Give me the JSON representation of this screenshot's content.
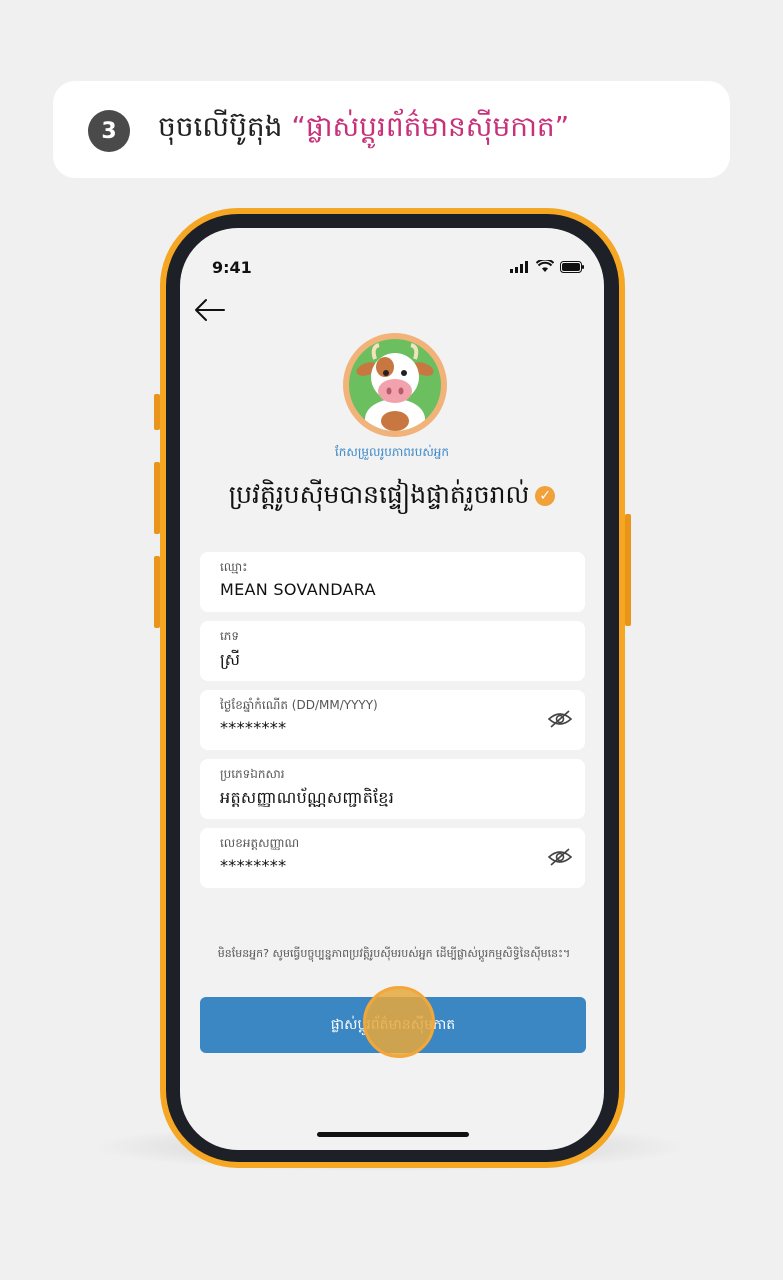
{
  "instruction": {
    "step_number": "3",
    "text_prefix": "ចុចលើប៊ូតុង ",
    "highlight": "“ផ្លាស់ប្តូរព័ត៌មានស៊ីមកាត”"
  },
  "status_bar": {
    "time": "9:41"
  },
  "profile": {
    "edit_link": "កែសម្រួលរូបភាពរបស់អ្នក",
    "verified_title": "ប្រវត្តិរូបស៊ីមបានផ្ទៀងផ្ទាត់រួចរាល់",
    "check_glyph": "✓"
  },
  "fields": [
    {
      "label": "ឈ្មោះ",
      "value": "MEAN SOVANDARA",
      "masked": false
    },
    {
      "label": "ភេទ",
      "value": "ស្រី",
      "masked": false
    },
    {
      "label": "ថ្ងៃខែឆ្នាំកំណើត (DD/MM/YYYY)",
      "value": "********",
      "masked": true
    },
    {
      "label": "ប្រភេទឯកសារ",
      "value": "អត្តសញ្ញាណប័ណ្ណសញ្ជាតិខ្មែរ",
      "masked": false
    },
    {
      "label": "លេខអត្តសញ្ញាណ",
      "value": "********",
      "masked": true
    }
  ],
  "notice": "មិនមែនអ្នក? សូមធ្វើបច្ចុប្បន្នភាពប្រវត្តិរូបស៊ីមរបស់អ្នក ដើម្បីផ្លាស់ប្តូរកម្មសិទ្ធិនៃស៊ីមនេះ។",
  "primary_button": {
    "label": "ផ្លាស់ប្តូរព័ត៌មានស៊ីមកាត"
  },
  "colors": {
    "accent_pink": "#c6317a",
    "primary_blue": "#3a87c3",
    "phone_orange": "#f5a623",
    "check_orange": "#f0a13a"
  },
  "icons": [
    "back-arrow-icon",
    "signal-icon",
    "wifi-icon",
    "battery-icon",
    "eye-off-icon",
    "check-badge-icon"
  ]
}
